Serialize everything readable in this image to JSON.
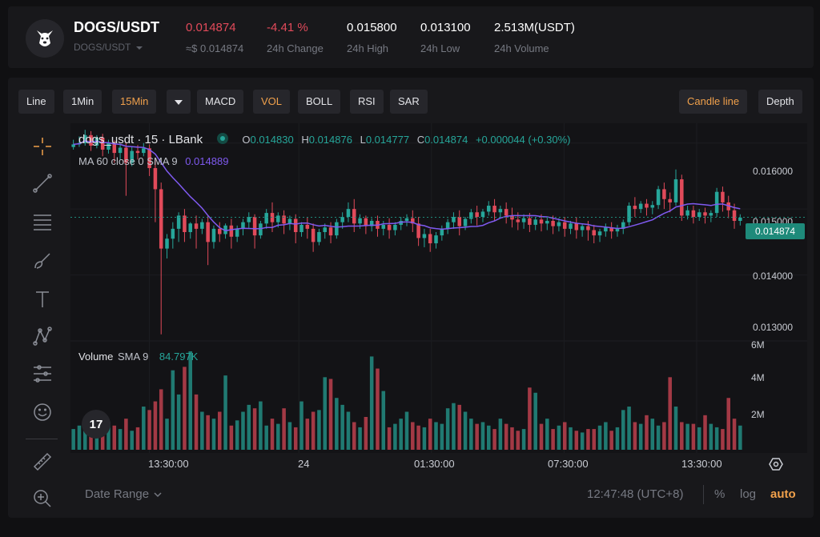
{
  "ticker": {
    "pair": "DOGS/USDT",
    "pair_sub": "DOGS/USDT",
    "price": "0.014874",
    "price_usd": "≈$ 0.014874",
    "change": "-4.41 %",
    "change_label": "24h Change",
    "high": "0.015800",
    "high_label": "24h High",
    "low": "0.013100",
    "low_label": "24h Low",
    "volume": "2.513M(USDT)",
    "volume_label": "24h Volume"
  },
  "toolbar": {
    "line": "Line",
    "min1": "1Min",
    "min15": "15Min",
    "macd": "MACD",
    "vol": "VOL",
    "boll": "BOLL",
    "rsi": "RSI",
    "sar": "SAR",
    "candle_line": "Candle line",
    "depth": "Depth"
  },
  "legend": {
    "symbol": "dogs_usdt · 15 · LBank",
    "o_label": "O",
    "o_value": "0.014830",
    "h_label": "H",
    "h_value": "0.014876",
    "l_label": "L",
    "l_value": "0.014777",
    "c_label": "C",
    "c_value": "0.014874",
    "change": "+0.000044 (+0.30%)",
    "ma_label": "MA 60 close 0 SMA 9",
    "ma_value": "0.014889",
    "vol_label": "Volume",
    "vol_sma": "SMA 9",
    "vol_value": "84.797K"
  },
  "price_axis": [
    "0.016000",
    "0.015000",
    "0.014000",
    "0.013000"
  ],
  "last_price_tag": "0.014874",
  "volume_axis": [
    "6M",
    "4M",
    "2M"
  ],
  "time_axis": [
    "13:30:00",
    "24",
    "01:30:00",
    "07:30:00",
    "13:30:00"
  ],
  "footer": {
    "date_range": "Date Range",
    "time": "12:47:48 (UTC+8)",
    "percent": "%",
    "log": "log",
    "auto": "auto"
  },
  "colors": {
    "up": "#26a69a",
    "down": "#e14a5a",
    "ma": "#7f5af0",
    "accent": "#f0a04b",
    "background": "#18181b"
  },
  "chart_data": {
    "type": "candlestick",
    "price_scale": [
      0.013,
      0.0163
    ],
    "volume_scale_millions": [
      0,
      6.3
    ],
    "current_price": 0.014874,
    "candles": [
      [
        0.01594,
        0.01605,
        0.01598,
        0.0159
      ],
      [
        0.01598,
        0.0161,
        0.016,
        0.01594
      ],
      [
        0.016,
        0.0162,
        0.01612,
        0.01596
      ],
      [
        0.01612,
        0.01618,
        0.01596,
        0.01588
      ],
      [
        0.01596,
        0.01612,
        0.01608,
        0.01592
      ],
      [
        0.01608,
        0.01614,
        0.0159,
        0.0158
      ],
      [
        0.0159,
        0.01605,
        0.016,
        0.01584
      ],
      [
        0.016,
        0.01604,
        0.01585,
        0.0157
      ],
      [
        0.01585,
        0.01598,
        0.01593,
        0.01575
      ],
      [
        0.01593,
        0.016,
        0.0157,
        0.0152
      ],
      [
        0.0157,
        0.01595,
        0.01588,
        0.01565
      ],
      [
        0.01588,
        0.01597,
        0.01585,
        0.01575
      ],
      [
        0.01585,
        0.016,
        0.01592,
        0.0158
      ],
      [
        0.01592,
        0.01598,
        0.01562,
        0.0155
      ],
      [
        0.01562,
        0.01578,
        0.0153,
        0.0148
      ],
      [
        0.0153,
        0.0154,
        0.0144,
        0.0131
      ],
      [
        0.0144,
        0.01462,
        0.01455,
        0.01425
      ],
      [
        0.01455,
        0.0148,
        0.0147,
        0.0144
      ],
      [
        0.0147,
        0.01495,
        0.0149,
        0.0145
      ],
      [
        0.0149,
        0.015,
        0.01465,
        0.0145
      ],
      [
        0.01465,
        0.0148,
        0.01478,
        0.01455
      ],
      [
        0.01478,
        0.0149,
        0.0147,
        0.0144
      ],
      [
        0.0147,
        0.01485,
        0.0148,
        0.01462
      ],
      [
        0.0148,
        0.0149,
        0.0145,
        0.01415
      ],
      [
        0.0145,
        0.01475,
        0.0147,
        0.0144
      ],
      [
        0.0147,
        0.0148,
        0.01462,
        0.0145
      ],
      [
        0.01462,
        0.01478,
        0.01475,
        0.01455
      ],
      [
        0.01475,
        0.01485,
        0.01458,
        0.0144
      ],
      [
        0.01458,
        0.01475,
        0.0147,
        0.0145
      ],
      [
        0.0147,
        0.01485,
        0.0148,
        0.0146
      ],
      [
        0.0148,
        0.01495,
        0.01488,
        0.0147
      ],
      [
        0.01488,
        0.01492,
        0.0146,
        0.0144
      ],
      [
        0.0146,
        0.01482,
        0.01478,
        0.01455
      ],
      [
        0.01478,
        0.015,
        0.01494,
        0.0147
      ],
      [
        0.01494,
        0.0151,
        0.0148,
        0.01465
      ],
      [
        0.0148,
        0.01495,
        0.0149,
        0.01472
      ],
      [
        0.0149,
        0.01498,
        0.01478,
        0.01462
      ],
      [
        0.01478,
        0.0149,
        0.01485,
        0.01468
      ],
      [
        0.01485,
        0.01492,
        0.01465,
        0.01448
      ],
      [
        0.01465,
        0.0148,
        0.01476,
        0.01458
      ],
      [
        0.01476,
        0.01488,
        0.0147,
        0.01455
      ],
      [
        0.0147,
        0.01478,
        0.0145,
        0.01435
      ],
      [
        0.0145,
        0.0147,
        0.01465,
        0.01445
      ],
      [
        0.01465,
        0.01478,
        0.01472,
        0.01455
      ],
      [
        0.01472,
        0.0148,
        0.0146,
        0.01448
      ],
      [
        0.0146,
        0.01485,
        0.0148,
        0.01455
      ],
      [
        0.0148,
        0.01495,
        0.01488,
        0.0147
      ],
      [
        0.01488,
        0.0151,
        0.015,
        0.0148
      ],
      [
        0.015,
        0.01515,
        0.01478,
        0.01465
      ],
      [
        0.01478,
        0.01492,
        0.01486,
        0.0147
      ],
      [
        0.01486,
        0.0149,
        0.01474,
        0.01462
      ],
      [
        0.01474,
        0.01486,
        0.01482,
        0.01466
      ],
      [
        0.01482,
        0.0149,
        0.0147,
        0.01458
      ],
      [
        0.0147,
        0.01482,
        0.01476,
        0.0146
      ],
      [
        0.01476,
        0.01486,
        0.01468,
        0.01455
      ],
      [
        0.01468,
        0.0148,
        0.01476,
        0.0146
      ],
      [
        0.01476,
        0.01488,
        0.01482,
        0.01468
      ],
      [
        0.01482,
        0.01492,
        0.01486,
        0.01474
      ],
      [
        0.01486,
        0.01498,
        0.01478,
        0.01465
      ],
      [
        0.01478,
        0.01488,
        0.01456,
        0.01444
      ],
      [
        0.01456,
        0.0147,
        0.01462,
        0.01442
      ],
      [
        0.01462,
        0.0147,
        0.01448,
        0.01435
      ],
      [
        0.01448,
        0.01465,
        0.0146,
        0.0144
      ],
      [
        0.0146,
        0.01475,
        0.0147,
        0.01452
      ],
      [
        0.0147,
        0.01485,
        0.0148,
        0.01462
      ],
      [
        0.0148,
        0.01495,
        0.01488,
        0.0147
      ],
      [
        0.01488,
        0.01498,
        0.01474,
        0.0146
      ],
      [
        0.01474,
        0.01488,
        0.01485,
        0.01468
      ],
      [
        0.01485,
        0.015,
        0.01495,
        0.01478
      ],
      [
        0.01495,
        0.01505,
        0.01488,
        0.01475
      ],
      [
        0.01488,
        0.015,
        0.01496,
        0.0148
      ],
      [
        0.01496,
        0.01512,
        0.01505,
        0.0149
      ],
      [
        0.01505,
        0.01515,
        0.01495,
        0.01482
      ],
      [
        0.01495,
        0.01505,
        0.015,
        0.01486
      ],
      [
        0.015,
        0.0151,
        0.0149,
        0.01478
      ],
      [
        0.0149,
        0.01502,
        0.01484,
        0.01472
      ],
      [
        0.01484,
        0.01495,
        0.0148,
        0.01468
      ],
      [
        0.0148,
        0.01492,
        0.01486,
        0.0147
      ],
      [
        0.01486,
        0.01494,
        0.01476,
        0.01465
      ],
      [
        0.01476,
        0.01488,
        0.01484,
        0.01468
      ],
      [
        0.01484,
        0.01492,
        0.01478,
        0.01466
      ],
      [
        0.01478,
        0.01488,
        0.01482,
        0.01468
      ],
      [
        0.01482,
        0.0149,
        0.01474,
        0.01462
      ],
      [
        0.01474,
        0.01486,
        0.0148,
        0.01466
      ],
      [
        0.0148,
        0.01488,
        0.0147,
        0.01458
      ],
      [
        0.0147,
        0.01482,
        0.01478,
        0.01462
      ],
      [
        0.01478,
        0.01488,
        0.01468,
        0.01455
      ],
      [
        0.01468,
        0.01478,
        0.01474,
        0.01458
      ],
      [
        0.01474,
        0.01482,
        0.01468,
        0.01452
      ],
      [
        0.01468,
        0.01476,
        0.0146,
        0.01448
      ],
      [
        0.0146,
        0.0147,
        0.01466,
        0.0145
      ],
      [
        0.01466,
        0.01478,
        0.01472,
        0.01458
      ],
      [
        0.01472,
        0.0148,
        0.01466,
        0.01455
      ],
      [
        0.01466,
        0.01476,
        0.0147,
        0.01458
      ],
      [
        0.0147,
        0.01484,
        0.0148,
        0.01462
      ],
      [
        0.0148,
        0.0151,
        0.01505,
        0.01475
      ],
      [
        0.01505,
        0.01518,
        0.015,
        0.01488
      ],
      [
        0.015,
        0.01512,
        0.01508,
        0.01494
      ],
      [
        0.01508,
        0.01515,
        0.01502,
        0.0149
      ],
      [
        0.01502,
        0.01512,
        0.01506,
        0.01492
      ],
      [
        0.01506,
        0.01535,
        0.0153,
        0.015
      ],
      [
        0.0153,
        0.0154,
        0.01515,
        0.015
      ],
      [
        0.01515,
        0.01525,
        0.0151,
        0.01495
      ],
      [
        0.0151,
        0.0156,
        0.01545,
        0.01505
      ],
      [
        0.01545,
        0.01552,
        0.0149,
        0.01482
      ],
      [
        0.0149,
        0.01505,
        0.01498,
        0.01484
      ],
      [
        0.01498,
        0.01505,
        0.01488,
        0.01478
      ],
      [
        0.01488,
        0.015,
        0.01495,
        0.01482
      ],
      [
        0.01495,
        0.01502,
        0.0149,
        0.01478
      ],
      [
        0.0149,
        0.01498,
        0.01494,
        0.0148
      ],
      [
        0.01494,
        0.01532,
        0.01526,
        0.01488
      ],
      [
        0.01526,
        0.01534,
        0.0151,
        0.01496
      ],
      [
        0.0151,
        0.0152,
        0.01498,
        0.01486
      ],
      [
        0.01498,
        0.01508,
        0.01482,
        0.0147
      ],
      [
        0.01482,
        0.01492,
        0.01487,
        0.01475
      ]
    ],
    "volume_millions": [
      1.2,
      1.4,
      1.1,
      1.5,
      1.3,
      2.0,
      1.6,
      1.4,
      1.2,
      1.8,
      1.1,
      1.3,
      2.5,
      2.3,
      2.8,
      3.5,
      1.8,
      4.6,
      3.2,
      4.8,
      5.7,
      3.2,
      2.2,
      2.0,
      1.8,
      2.2,
      4.3,
      1.4,
      1.7,
      2.2,
      2.6,
      2.4,
      2.8,
      1.4,
      1.8,
      1.5,
      2.4,
      1.6,
      1.3,
      2.8,
      1.8,
      2.2,
      2.3,
      4.2,
      4.1,
      3.0,
      2.6,
      2.2,
      1.6,
      1.3,
      1.9,
      5.4,
      4.7,
      3.4,
      1.3,
      1.5,
      1.8,
      2.2,
      1.6,
      1.4,
      1.3,
      1.8,
      1.6,
      1.5,
      2.4,
      2.7,
      2.6,
      2.2,
      1.8,
      1.5,
      1.6,
      1.4,
      1.2,
      1.8,
      1.5,
      1.3,
      1.1,
      1.2,
      3.6,
      3.3,
      1.5,
      1.8,
      1.2,
      1.4,
      1.6,
      1.3,
      1.1,
      1.0,
      1.2,
      1.2,
      1.4,
      1.6,
      1.1,
      1.3,
      2.3,
      2.5,
      1.6,
      1.5,
      2.0,
      1.8,
      1.4,
      1.6,
      4.2,
      2.5,
      1.6,
      1.5,
      1.5,
      1.3,
      2.0,
      1.5,
      1.3,
      1.2,
      3.0,
      1.8,
      1.4
    ]
  }
}
